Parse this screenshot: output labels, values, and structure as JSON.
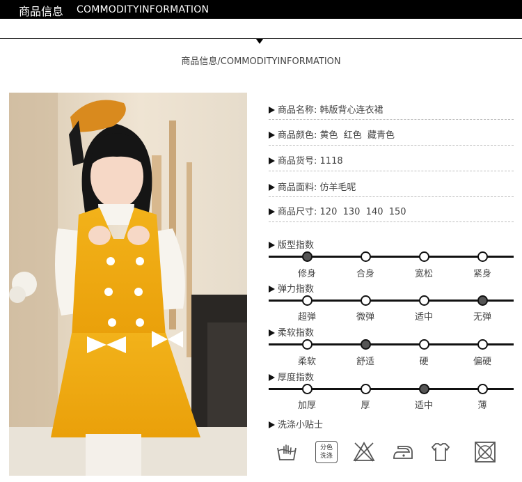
{
  "header": {
    "title_cn": "商品信息",
    "title_en": "COMMODITYINFORMATION"
  },
  "subtitle": "商品信息/COMMODITYINFORMATION",
  "product_info": [
    {
      "label": "商品名称:",
      "value": "韩版背心连衣裙"
    },
    {
      "label": "商品颜色:",
      "value": "黄色  红色  藏青色"
    },
    {
      "label": "商品货号:",
      "value": "1118"
    },
    {
      "label": "商品面料:",
      "value": "仿羊毛呢"
    },
    {
      "label": "商品尺寸:",
      "value": "120  130  140  150"
    }
  ],
  "indices": [
    {
      "title": "版型指数",
      "options": [
        "修身",
        "合身",
        "宽松",
        "紧身"
      ],
      "selected": 0
    },
    {
      "title": "弹力指数",
      "options": [
        "超弹",
        "微弹",
        "适中",
        "无弹"
      ],
      "selected": 3
    },
    {
      "title": "柔软指数",
      "options": [
        "柔软",
        "舒适",
        "硬",
        "偏硬"
      ],
      "selected": 1
    },
    {
      "title": "厚度指数",
      "options": [
        "加厚",
        "厚",
        "适中",
        "薄"
      ],
      "selected": 2
    }
  ],
  "care": {
    "title": "洗涤小贴士",
    "icons": [
      "hand-wash-icon",
      "wash-colors-separately-icon",
      "no-bleach-icon",
      "iron-icon",
      "hang-dry-icon",
      "no-tumble-dry-icon"
    ],
    "separate_text": "分色洗涤"
  },
  "colors": {
    "selected_dot": "#555555",
    "product_yellow": "#f0a911"
  }
}
